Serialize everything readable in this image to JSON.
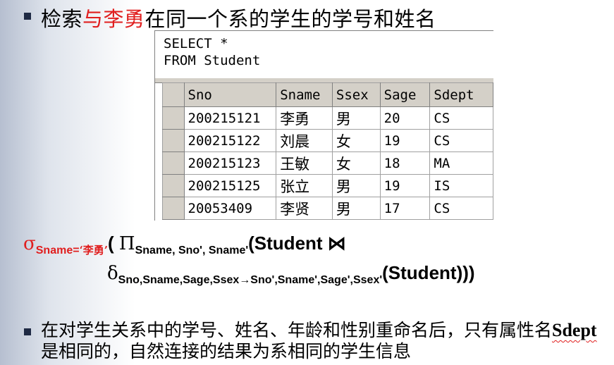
{
  "slide": {
    "title_prefix": "检索",
    "title_highlight": "与李勇",
    "title_suffix": "在同一个系的学生的学号和姓名"
  },
  "sql": {
    "line1": "SELECT *",
    "line2": "FROM Student"
  },
  "result_table": {
    "columns": [
      "Sno",
      "Sname",
      "Ssex",
      "Sage",
      "Sdept"
    ],
    "rows": [
      [
        "200215121",
        "李勇",
        "男",
        "20",
        "CS"
      ],
      [
        "200215122",
        "刘晨",
        "女",
        "19",
        "CS"
      ],
      [
        "200215123",
        "王敏",
        "女",
        "18",
        "MA"
      ],
      [
        "200215125",
        "张立",
        "男",
        "19",
        "IS"
      ],
      [
        "20053409",
        "李贤",
        "男",
        "17",
        "CS"
      ]
    ]
  },
  "formula": {
    "sigma": "σ",
    "sigma_cond": "Sname=",
    "sigma_value": "‘李勇’",
    "open_paren": "( ",
    "pi": "Π",
    "pi_attrs": "Sname, Sno', Sname'",
    "student_join": "(Student ⋈",
    "delta": "δ",
    "delta_attrs": "Sno,Sname,Sage,Ssex→Sno',Sname',Sage',Ssex'",
    "closing": "(Student)))"
  },
  "note": {
    "text_before": "在对学生关系中的学号、姓名、年龄和性别重命名后，只有属性名",
    "keyword": "Sdept",
    "text_after": "是相同的，自然连接的结果为系相同的学生信息"
  }
}
